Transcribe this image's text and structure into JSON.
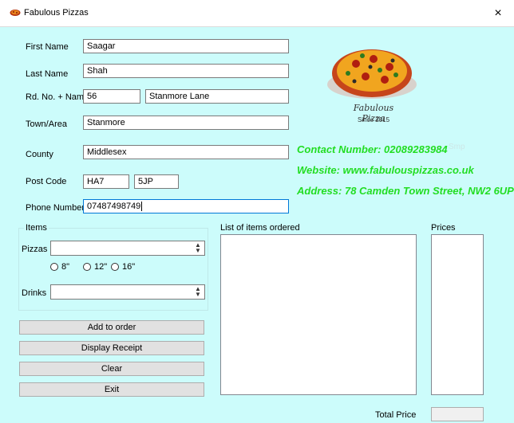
{
  "window": {
    "title": "Fabulous Pizzas",
    "close_symbol": "×",
    "icon": "pizza-icon",
    "background": "#ccfcfb"
  },
  "form": {
    "first_name": {
      "label": "First Name",
      "value": "Saagar"
    },
    "last_name": {
      "label": "Last Name",
      "value": "Shah"
    },
    "road": {
      "label": "Rd. No. + Name",
      "number": "56",
      "name": "Stanmore Lane"
    },
    "town": {
      "label": "Town/Area",
      "value": "Stanmore"
    },
    "county": {
      "label": "County",
      "value": "Middlesex"
    },
    "postcode": {
      "label": "Post Code",
      "part1": "HA7",
      "part2": "5JP"
    },
    "phone": {
      "label": "Phone Number",
      "value": "07487498749"
    }
  },
  "logo": {
    "script_text": "Fabulous Pizza",
    "since_text": "Since 2015"
  },
  "contact": {
    "phone_line": "Contact Number: 02089283984",
    "website_line": "Website: www.fabulouspizzas.co.uk",
    "address_line": "Address: 78 Camden Town Street, NW2 6UP",
    "faded_text": "Smp",
    "color": "#22dd22"
  },
  "items": {
    "group_label": "Items",
    "pizzas_label": "Pizzas",
    "pizzas_value": "",
    "sizes": [
      "8\"",
      "12\"",
      "16\""
    ],
    "drinks_label": "Drinks",
    "drinks_value": ""
  },
  "buttons": {
    "add": "Add to order",
    "receipt": "Display Receipt",
    "clear": "Clear",
    "exit": "Exit"
  },
  "order": {
    "list_label": "List of items ordered",
    "prices_label": "Prices",
    "total_label": "Total Price",
    "total_value": ""
  }
}
